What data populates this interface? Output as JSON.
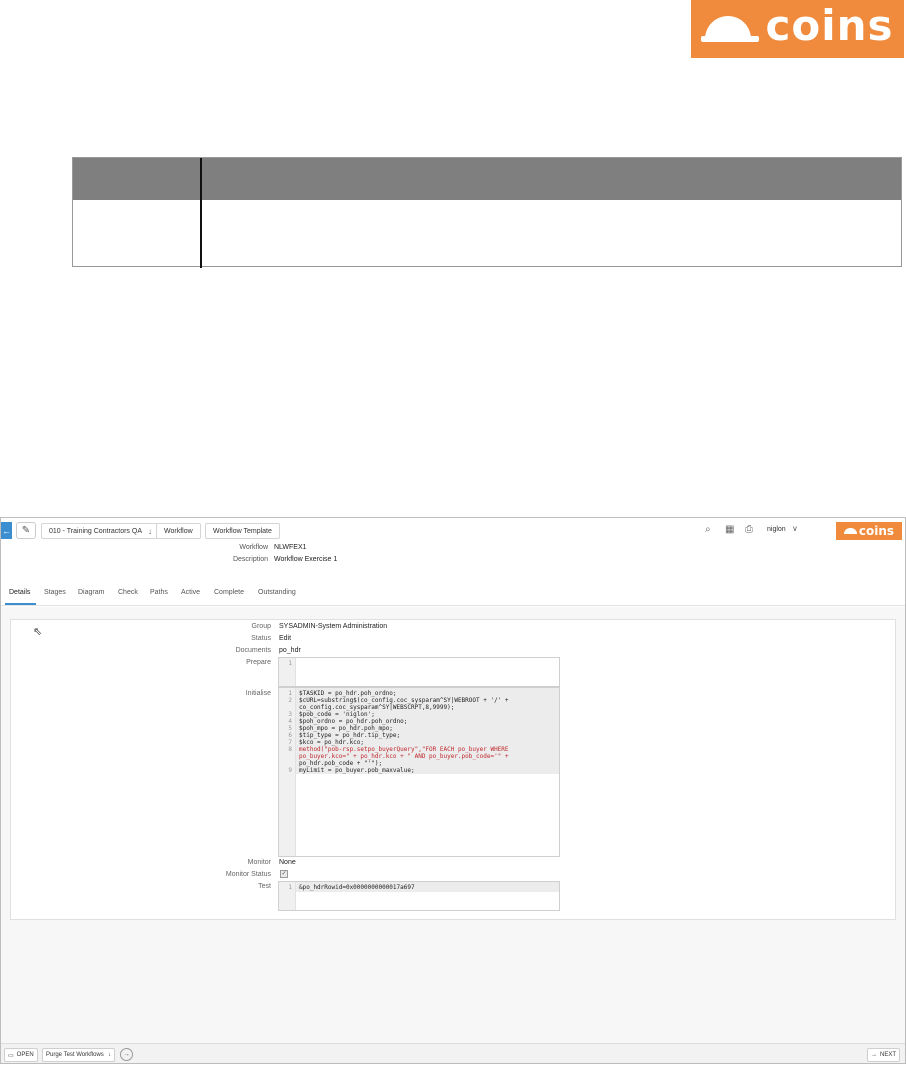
{
  "doc": {
    "logo_text": "coins"
  },
  "app": {
    "breadcrumbs": [
      "010 - Training Contractors QA",
      "Workflow",
      "Workflow Template"
    ],
    "user": "niglon",
    "logo_text": "coins",
    "header": {
      "workflow_label": "Workflow",
      "workflow_value": "NLWFEX1",
      "description_label": "Description",
      "description_value": "Workflow Exercise 1"
    },
    "tabs": [
      "Details",
      "Stages",
      "Diagram",
      "Check",
      "Paths",
      "Active",
      "Complete",
      "Outstanding"
    ],
    "active_tab": "Details",
    "form": {
      "group_label": "Group",
      "group_value": "SYSADMIN-System Administration",
      "status_label": "Status",
      "status_value": "Edit",
      "documents_label": "Documents",
      "documents_value": "po_hdr",
      "prepare_label": "Prepare",
      "initialise_label": "Initialise",
      "monitor_label": "Monitor",
      "monitor_value": "None",
      "monitor_status_label": "Monitor Status",
      "monitor_status_checked": true,
      "test_label": "Test"
    },
    "prepare_code": [
      {
        "n": "1",
        "t": ""
      }
    ],
    "initialise_code": [
      {
        "n": "1",
        "t": "$TASKID = po_hdr.poh_ordno;",
        "c": "dark"
      },
      {
        "n": "2",
        "t": "$cURL=substring$(co_config.coc_sysparam^SY|WEBROOT + '/' +",
        "c": "dark"
      },
      {
        "n": "",
        "t": "co_config.coc_sysparam^SY|WEBSCRPT,8,9999);",
        "c": "dark"
      },
      {
        "n": "3",
        "t": "$pob_code = 'niglon';",
        "c": "dark"
      },
      {
        "n": "4",
        "t": "$poh_ordno = po_hdr.poh_ordno;",
        "c": "dark"
      },
      {
        "n": "5",
        "t": "$poh_mpo = po_hdr.poh_mpo;",
        "c": "dark"
      },
      {
        "n": "6",
        "t": "$tip_type = po_hdr.tip_type;",
        "c": "dark"
      },
      {
        "n": "7",
        "t": "$kco = po_hdr.kco;",
        "c": "dark"
      },
      {
        "n": "8",
        "t": "method(\"pob-rsp.setpo_buyerQuery\",\"FOR EACH po_buyer WHERE",
        "c": "red"
      },
      {
        "n": "",
        "t": "po_buyer.kco=\" + po_hdr.kco + \" AND po_buyer.pob_code='\" +",
        "c": "red"
      },
      {
        "n": "",
        "t": "po_hdr.pob_code + \"'\");",
        "c": "dark"
      },
      {
        "n": "9",
        "t": "myLimit = po_buyer.pob_maxvalue;",
        "c": "dark"
      }
    ],
    "test_code": [
      {
        "n": "1",
        "t": "&po_hdrRowid=0x0000000000017a697"
      }
    ],
    "bottom": {
      "open_label": "OPEN",
      "purge_label": "Purge Test Workflows",
      "next_label": "NEXT"
    }
  }
}
